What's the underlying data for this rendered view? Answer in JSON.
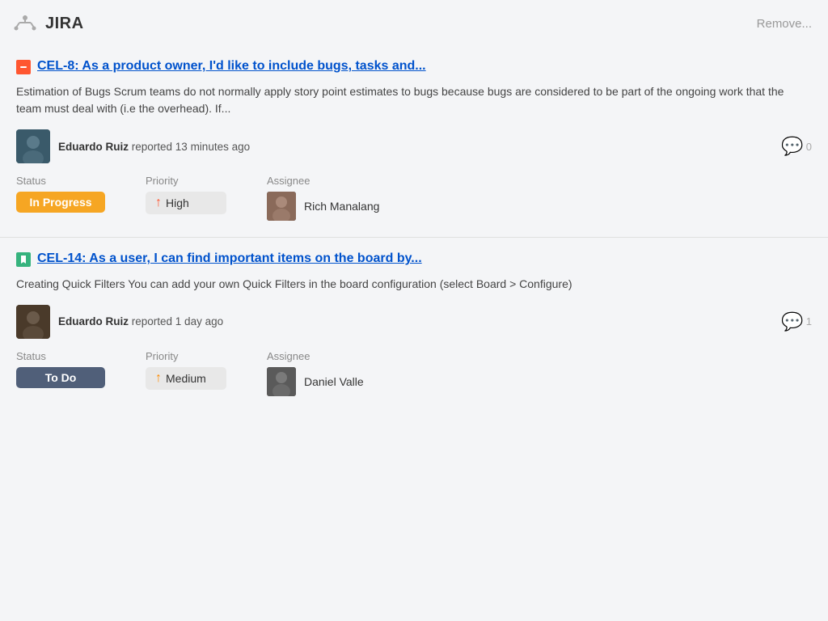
{
  "app": {
    "logo_icon": "jira-logo",
    "title": "JIRA",
    "remove_label": "Remove..."
  },
  "issues": [
    {
      "id": "issue-1",
      "type": "bug",
      "type_label": "Bug",
      "key": "CEL-8",
      "title": "CEL-8: As a product owner, I'd like to include bugs, tasks and...",
      "description": "Estimation of Bugs Scrum teams do not normally apply story point estimates to bugs because bugs are considered to be part of the ongoing work that the team must deal with (i.e the overhead). If...",
      "reporter_name": "Eduardo Ruiz",
      "reporter_text": "reported 13 minutes ago",
      "comments": "0",
      "status": "In Progress",
      "status_type": "in-progress",
      "priority": "High",
      "priority_type": "high",
      "assignee_name": "Rich Manalang"
    },
    {
      "id": "issue-2",
      "type": "story",
      "type_label": "Story",
      "key": "CEL-14",
      "title": "CEL-14: As a user, I can find important items on the board by...",
      "description": "Creating Quick Filters You can add your own Quick Filters in the board configuration (select Board > Configure)",
      "reporter_name": "Eduardo Ruiz",
      "reporter_text": "reported 1 day ago",
      "comments": "1",
      "status": "To Do",
      "status_type": "to-do",
      "priority": "Medium",
      "priority_type": "medium",
      "assignee_name": "Daniel Valle"
    }
  ],
  "labels": {
    "status": "Status",
    "priority": "Priority",
    "assignee": "Assignee"
  }
}
